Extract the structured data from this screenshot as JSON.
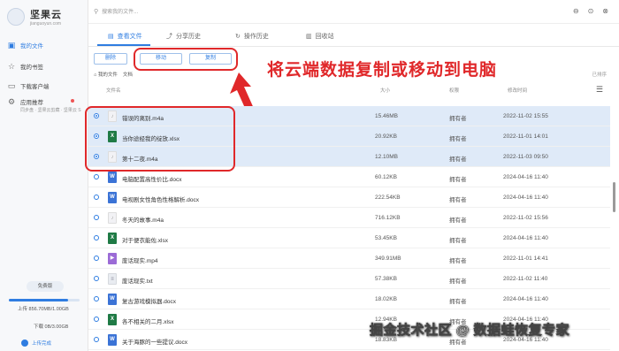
{
  "app": {
    "logo_title": "坚果云",
    "logo_sub": "jianguoyun.com"
  },
  "sidebar": {
    "items": [
      {
        "label": "我的文件",
        "icon": "folder-icon",
        "active": true
      },
      {
        "label": "我的书签",
        "icon": "star-icon",
        "active": false
      },
      {
        "label": "下载客户端",
        "icon": "download-icon",
        "active": false
      },
      {
        "label": "应用推荐",
        "sub": "同步盘 · 坚果云剪藏 · 坚果云 S",
        "icon": "apps-icon",
        "active": false
      }
    ],
    "upgrade_label": "免费版",
    "quota_upload": "上传 856.70MB/1.00GB",
    "quota_upload_ratio": 0.84,
    "quota_download": "下载 0B/3.00GB",
    "upload_link": "上传完成"
  },
  "search": {
    "placeholder": "搜索我的文件..."
  },
  "tabs": [
    {
      "label": "查看文件",
      "icon": "eye-icon",
      "active": true
    },
    {
      "label": "分享历史",
      "icon": "share-icon",
      "active": false
    },
    {
      "label": "操作历史",
      "icon": "history-icon",
      "active": false
    },
    {
      "label": "回收站",
      "icon": "trash-icon",
      "active": false
    }
  ],
  "actions": {
    "delete": "删除",
    "move": "移动",
    "copy": "复制"
  },
  "annotation": "将云端数据复制或移动到电脑",
  "breadcrumb": [
    "我的文件",
    "文档"
  ],
  "sort_label": "已排序",
  "table": {
    "headers": {
      "name": "文件名",
      "size": "大小",
      "perm": "权限",
      "date": "修改时间"
    },
    "rows": [
      {
        "name": "错误的离别.m4a",
        "size": "15.46MB",
        "perm": "拥有者",
        "date": "2022-11-02 15:55",
        "type": "audio",
        "selected": true
      },
      {
        "name": "当你途经我的绽放.xlsx",
        "size": "20.92KB",
        "perm": "拥有者",
        "date": "2022-11-01 14:01",
        "type": "excel",
        "selected": true
      },
      {
        "name": "第十二夜.m4a",
        "size": "12.10MB",
        "perm": "拥有者",
        "date": "2022-11-03 09:50",
        "type": "audio",
        "selected": true
      },
      {
        "name": "电脑配置高性价比.docx",
        "size": "60.12KB",
        "perm": "拥有者",
        "date": "2024-04-16 11:40",
        "type": "word",
        "selected": false
      },
      {
        "name": "电视剧女性角色性格解析.docx",
        "size": "222.54KB",
        "perm": "拥有者",
        "date": "2024-04-16 11:40",
        "type": "word",
        "selected": false
      },
      {
        "name": "冬天的故事.m4a",
        "size": "716.12KB",
        "perm": "拥有者",
        "date": "2022-11-02 15:56",
        "type": "audio",
        "selected": false
      },
      {
        "name": "对于便衣能佐.xlsx",
        "size": "53.45KB",
        "perm": "拥有者",
        "date": "2024-04-16 11:40",
        "type": "excel",
        "selected": false
      },
      {
        "name": "废话现实.mp4",
        "size": "349.91MB",
        "perm": "拥有者",
        "date": "2022-11-01 14:41",
        "type": "video",
        "selected": false
      },
      {
        "name": "废话现实.txt",
        "size": "57.38KB",
        "perm": "拥有者",
        "date": "2022-11-02 11:40",
        "type": "text",
        "selected": false
      },
      {
        "name": "复古游戏模拟器.docx",
        "size": "18.02KB",
        "perm": "拥有者",
        "date": "2024-04-16 11:40",
        "type": "word",
        "selected": false
      },
      {
        "name": "各不相关的二月.xlsx",
        "size": "12.94KB",
        "perm": "拥有者",
        "date": "2024-04-16 11:40",
        "type": "excel",
        "selected": false
      },
      {
        "name": "关于海豚的一些提议.docx",
        "size": "18.83KB",
        "perm": "拥有者",
        "date": "2024-04-16 11:40",
        "type": "word",
        "selected": false
      }
    ]
  },
  "watermark": "掘金技术社区 @ 数据蛙恢复专家"
}
